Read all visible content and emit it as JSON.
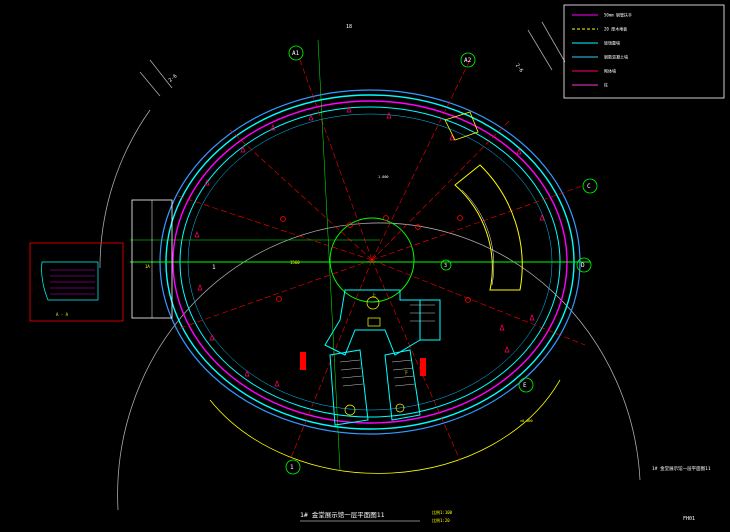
{
  "drawing": {
    "title": "1# 金堂展示馆一层平面图11",
    "scale_a": "比例1:100",
    "scale_b": "比例1:20",
    "side_title": "1# 金堂展示馆一层平面图11",
    "page_code": "FH01",
    "top_code": "18",
    "inset_label": "A - A"
  },
  "legend": [
    {
      "label": "50mm 钢管扶手",
      "color": "#ff00ff"
    },
    {
      "label": "20 厚木地板",
      "color": "#ffff00"
    },
    {
      "label": "玻璃幕墙",
      "color": "#00ffff"
    },
    {
      "label": "钢筋混凝土墙",
      "color": "#33ccff"
    },
    {
      "label": "砌体墙",
      "color": "#ff0066"
    },
    {
      "label": "柱",
      "color": "#ff33cc"
    }
  ],
  "axes": [
    {
      "label": "A1",
      "kind": "top-left"
    },
    {
      "label": "A2",
      "kind": "top-right"
    },
    {
      "label": "C",
      "kind": "right-upper"
    },
    {
      "label": "D",
      "kind": "right-lower"
    },
    {
      "label": "E",
      "kind": "bottom-right"
    },
    {
      "label": "1",
      "kind": "bottom-left"
    },
    {
      "label": "1",
      "kind": "left-tag"
    },
    {
      "label": "3",
      "kind": "center-right"
    }
  ],
  "annotations": {
    "dim_main": "1560",
    "dim_left": "1A",
    "center_mark": "1.000",
    "stair_up": "上",
    "stair_dn": "下",
    "road_a": "2-6",
    "road_b": "2-6",
    "level": "±0.000"
  },
  "colors": {
    "background": "#000000",
    "outer_ring": "#00ffff",
    "magenta_ring": "#ff00ff",
    "green_axis": "#00ff00",
    "red_axis": "#ff0000",
    "yellow": "#ffff00",
    "white": "#ffffff"
  }
}
